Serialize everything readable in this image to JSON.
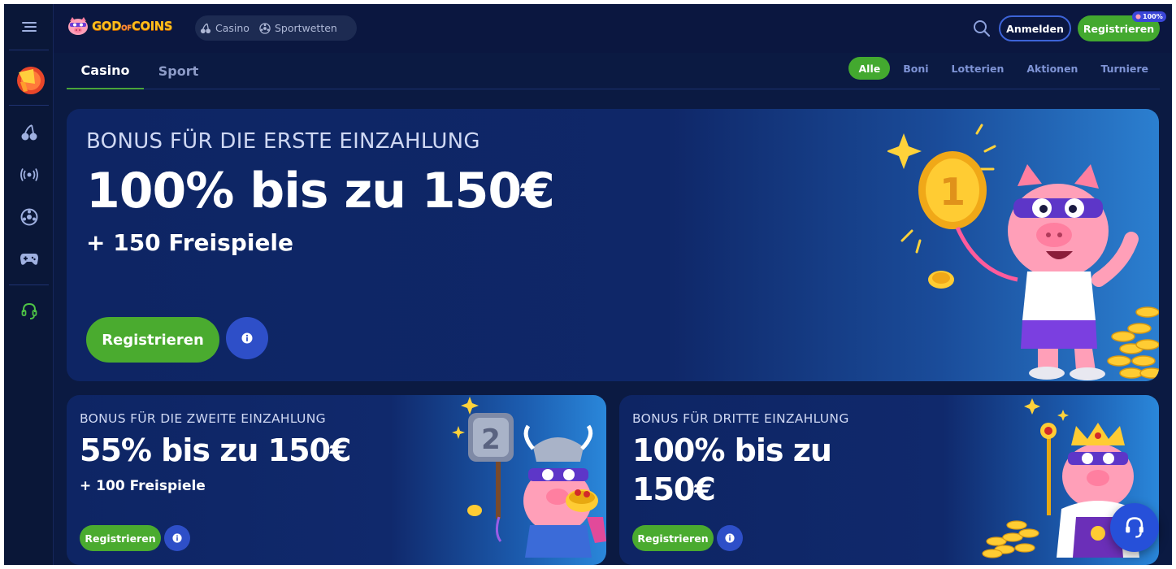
{
  "topbar": {
    "logo_text_1": "GOD",
    "logo_text_of": "OF",
    "logo_text_2": "COINS",
    "nav": [
      {
        "label": "Casino",
        "icon": "cherry-icon"
      },
      {
        "label": "Sportwetten",
        "icon": "football-icon"
      }
    ],
    "login_label": "Anmelden",
    "register_label": "Registrieren",
    "register_badge": "100%"
  },
  "sidebar": {
    "items": [
      {
        "name": "menu",
        "icon": "hamburger-menu-icon"
      },
      {
        "name": "promo",
        "icon": "megaphone-icon"
      },
      {
        "name": "casino",
        "icon": "cherry-icon"
      },
      {
        "name": "live",
        "icon": "live-broadcast-icon"
      },
      {
        "name": "sports",
        "icon": "football-icon"
      },
      {
        "name": "games",
        "icon": "gamepad-icon"
      },
      {
        "name": "support",
        "icon": "headset-icon"
      }
    ]
  },
  "tabs": [
    {
      "label": "Casino",
      "active": true
    },
    {
      "label": "Sport",
      "active": false
    }
  ],
  "filters": [
    {
      "label": "Alle",
      "active": true
    },
    {
      "label": "Boni",
      "active": false
    },
    {
      "label": "Lotterien",
      "active": false
    },
    {
      "label": "Aktionen",
      "active": false
    },
    {
      "label": "Turniere",
      "active": false
    }
  ],
  "banners": {
    "main": {
      "subtitle": "BONUS FÜR DIE ERSTE EINZAHLUNG",
      "title": "100% bis zu 150€",
      "extra": "+ 150 Freispiele",
      "button_label": "Registrieren"
    },
    "second": {
      "subtitle": "BONUS FÜR DIE ZWEITE EINZAHLUNG",
      "title": "55% bis zu 150€",
      "extra": "+ 100 Freispiele",
      "button_label": "Registrieren"
    },
    "third": {
      "subtitle": "BONUS FÜR DRITTE EINZAHLUNG",
      "title_line1": "100% bis zu",
      "title_line2": "150€",
      "button_label": "Registrieren"
    }
  },
  "colors": {
    "background": "#0b1a42",
    "accent_green": "#43a92f",
    "accent_blue": "#2e4fc8",
    "banner": "#0e2564"
  }
}
